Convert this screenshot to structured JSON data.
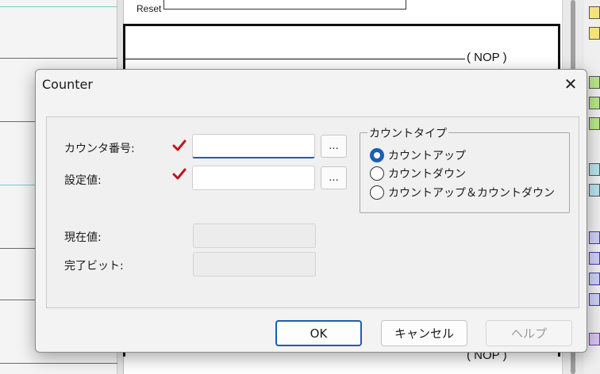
{
  "background": {
    "reset_label": "Reset",
    "nop_label": "( NOP )",
    "nop_bottom_label": "( NOP )"
  },
  "dialog": {
    "title": "Counter",
    "close_glyph": "✕",
    "fields": {
      "counter_number": {
        "label": "カウンタ番号:",
        "value": "",
        "browse_label": "..."
      },
      "preset_value": {
        "label": "設定値:",
        "value": "",
        "browse_label": "..."
      },
      "current_value": {
        "label": "現在値:",
        "value": ""
      },
      "done_bit": {
        "label": "完了ビット:",
        "value": ""
      }
    },
    "counter_type": {
      "legend": "カウントタイプ",
      "options": [
        {
          "label": "カウントアップ",
          "selected": true
        },
        {
          "label": "カウントダウン",
          "selected": false
        },
        {
          "label": "カウントアップ＆カウントダウン",
          "selected": false
        }
      ]
    },
    "buttons": {
      "ok": "OK",
      "cancel": "キャンセル",
      "help": "ヘルプ"
    },
    "colors": {
      "accent": "#1a5fb4",
      "check_mark": "#c0171d"
    }
  }
}
